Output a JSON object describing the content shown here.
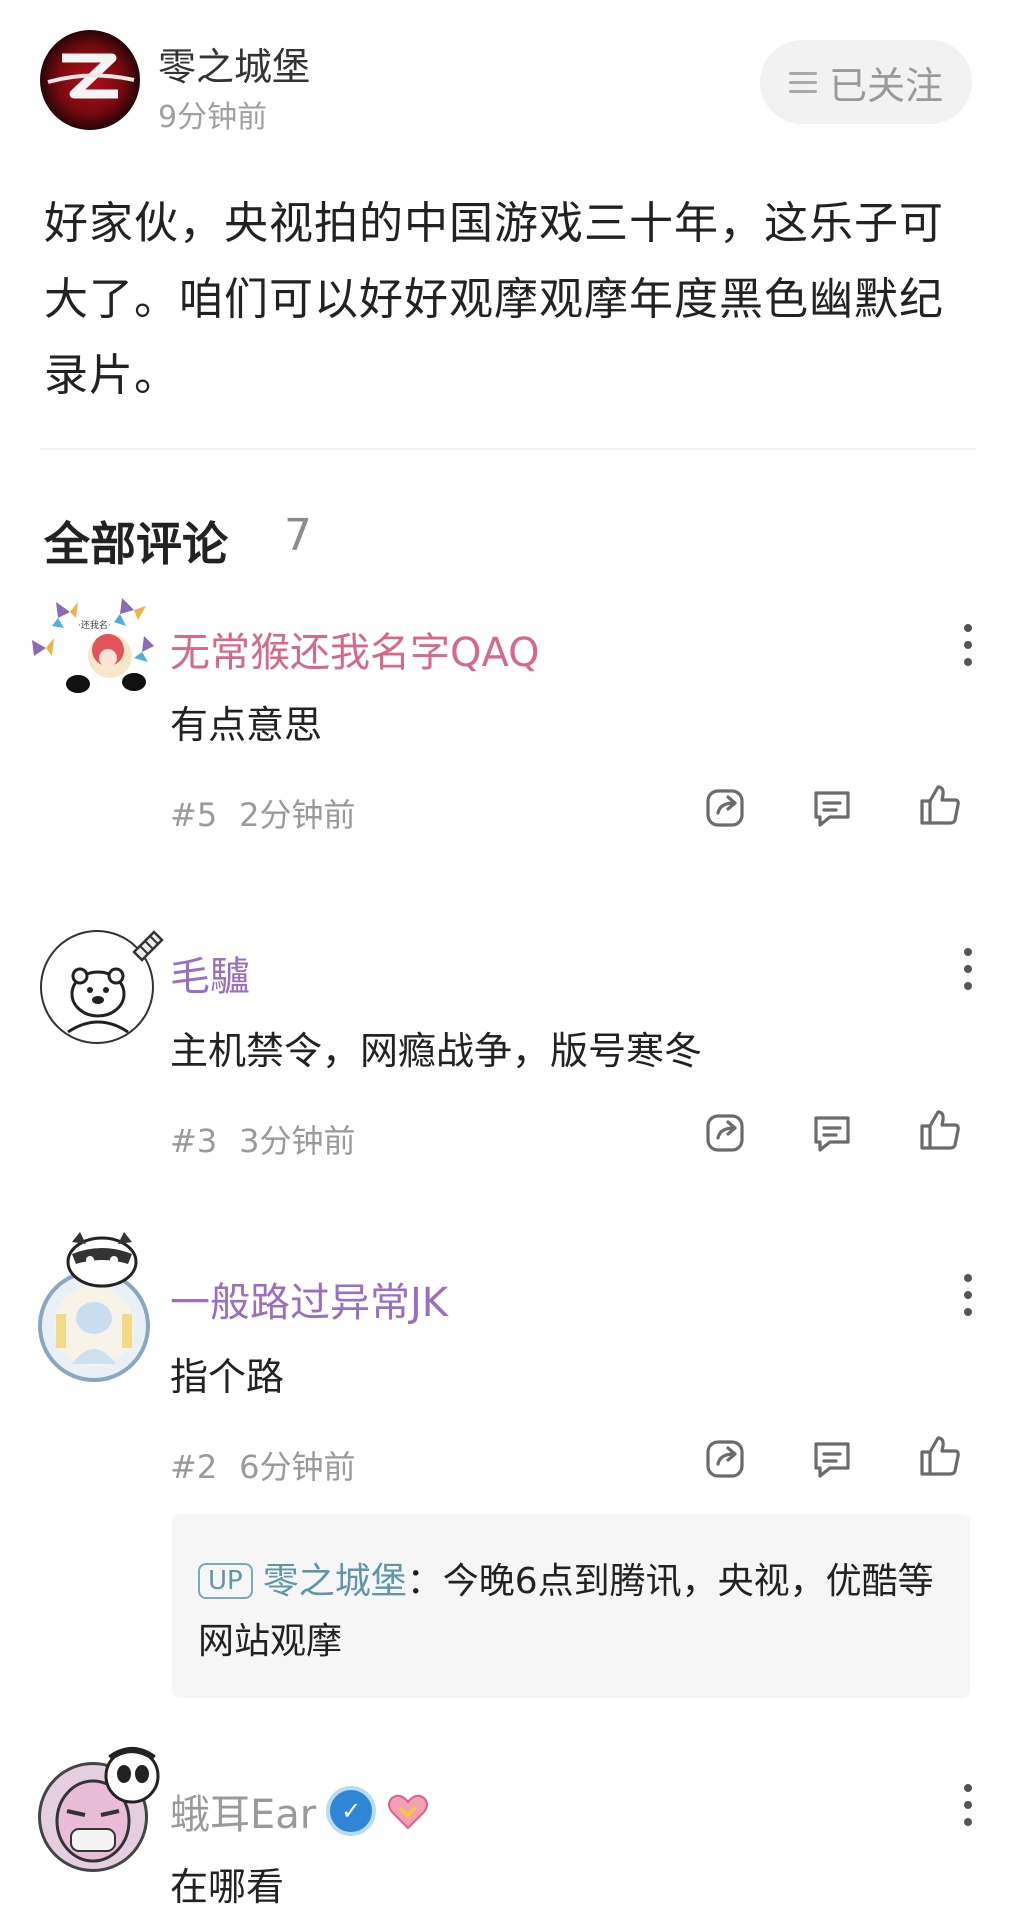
{
  "post": {
    "author": "零之城堡",
    "time": "9分钟前",
    "follow_label": "已关注",
    "body": "好家伙，央视拍的中国游戏三十年，这乐子可大了。咱们可以好好观摩观摩年度黑色幽默纪录片。"
  },
  "comments_section": {
    "title": "全部评论",
    "count": "7"
  },
  "comments": [
    {
      "name": "无常猴还我名字QAQ",
      "name_color": "#d46a8a",
      "text": "有点意思",
      "floor": "#5",
      "time": "2分钟前"
    },
    {
      "name": "毛驢",
      "name_color": "#9b6fc0",
      "text": "主机禁令，网瘾战争，版号寒冬",
      "floor": "#3",
      "time": "3分钟前"
    },
    {
      "name": "一般路过异常JK",
      "name_color": "#9b6fc0",
      "text": "指个路",
      "floor": "#2",
      "time": "6分钟前",
      "reply": {
        "tag": "UP",
        "author": "零之城堡",
        "separator": "：",
        "text": "今晚6点到腾讯，央视，优酷等网站观摩"
      }
    },
    {
      "name": "蛾耳Ear",
      "name_color": "#9a9a9a",
      "text": "在哪看"
    }
  ],
  "icons": {
    "share": "share-icon",
    "reply": "comment-icon",
    "like": "thumbs-up-icon",
    "more": "more-vertical-icon"
  }
}
